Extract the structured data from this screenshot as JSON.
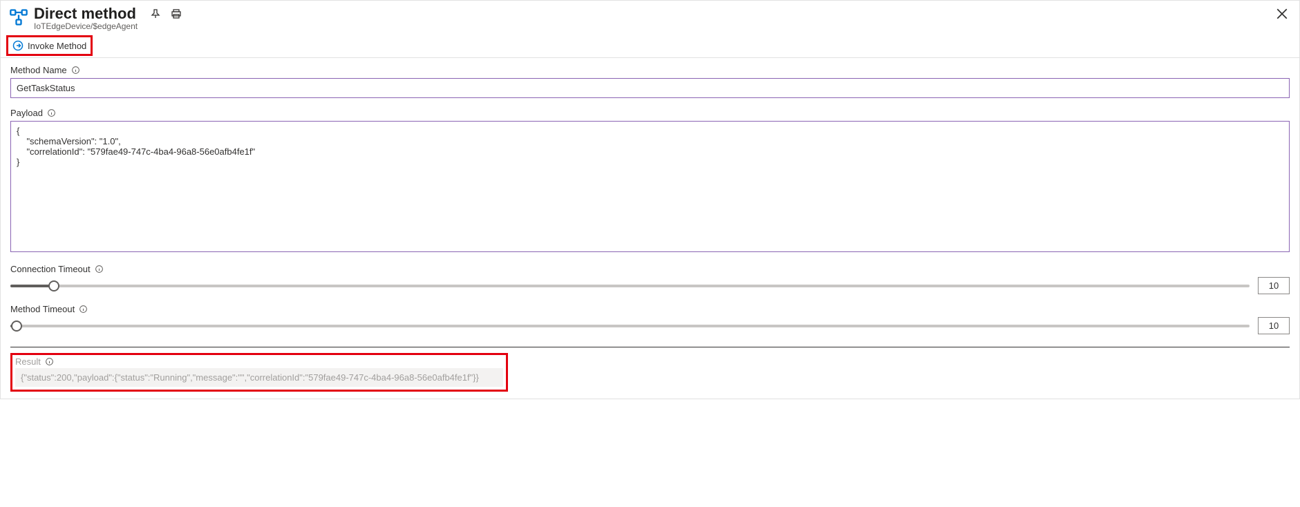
{
  "header": {
    "title": "Direct method",
    "subtitle": "IoTEdgeDevice/$edgeAgent"
  },
  "toolbar": {
    "invoke_label": "Invoke Method"
  },
  "fields": {
    "method_name_label": "Method Name",
    "method_name_value": "GetTaskStatus",
    "payload_label": "Payload",
    "payload_value": "{\n    \"schemaVersion\": \"1.0\",\n    \"correlationId\": \"579fae49-747c-4ba4-96a8-56e0afb4fe1f\"\n}",
    "connection_timeout_label": "Connection Timeout",
    "connection_timeout_value": "10",
    "method_timeout_label": "Method Timeout",
    "method_timeout_value": "10"
  },
  "result": {
    "label": "Result",
    "value": "{\"status\":200,\"payload\":{\"status\":\"Running\",\"message\":\"\",\"correlationId\":\"579fae49-747c-4ba4-96a8-56e0afb4fe1f\"}}"
  }
}
